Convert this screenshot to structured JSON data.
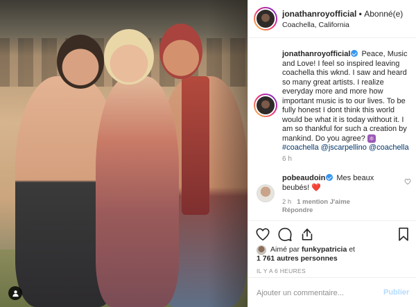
{
  "photo": {
    "alt_name": "coachella-photo"
  },
  "header": {
    "username": "jonathanroyofficial",
    "separator": " • ",
    "follow_status": "Abonné(e)",
    "location": "Coachella, California"
  },
  "caption": {
    "username": "jonathanroyofficial",
    "text": "Peace, Music and Love! I feel so inspired leaving coachella this wknd. I saw and heard so many great artists. I realize everyday more and more how important music is to our lives. To be fully honest I dont think this world would be what it is today without it. I am so thankful for such a creation by mankind. Do you agree?",
    "emoji": "⚛",
    "hashtag": "#coachella",
    "mention1": "@jscarpellino",
    "mention2": "@coachella",
    "time": "6 h"
  },
  "comment": {
    "username": "pobeaudoin",
    "text": "Mes beaux beubés!",
    "emoji": "❤️",
    "time": "2 h",
    "likes": "1 mention J'aime",
    "reply": "Répondre"
  },
  "likes": {
    "prefix": "Aimé par",
    "liker": "funkypatricia",
    "suffix": "et",
    "count": "1 761 autres personnes"
  },
  "posted": "IL Y A 6 HEURES",
  "add_comment": {
    "placeholder": "Ajouter un commentaire...",
    "publish_label": "Publier"
  },
  "colors": {
    "link": "#003569",
    "verified": "#3897f0",
    "publish_disabled": "#b3dbff",
    "muted": "#8e8e8e"
  }
}
